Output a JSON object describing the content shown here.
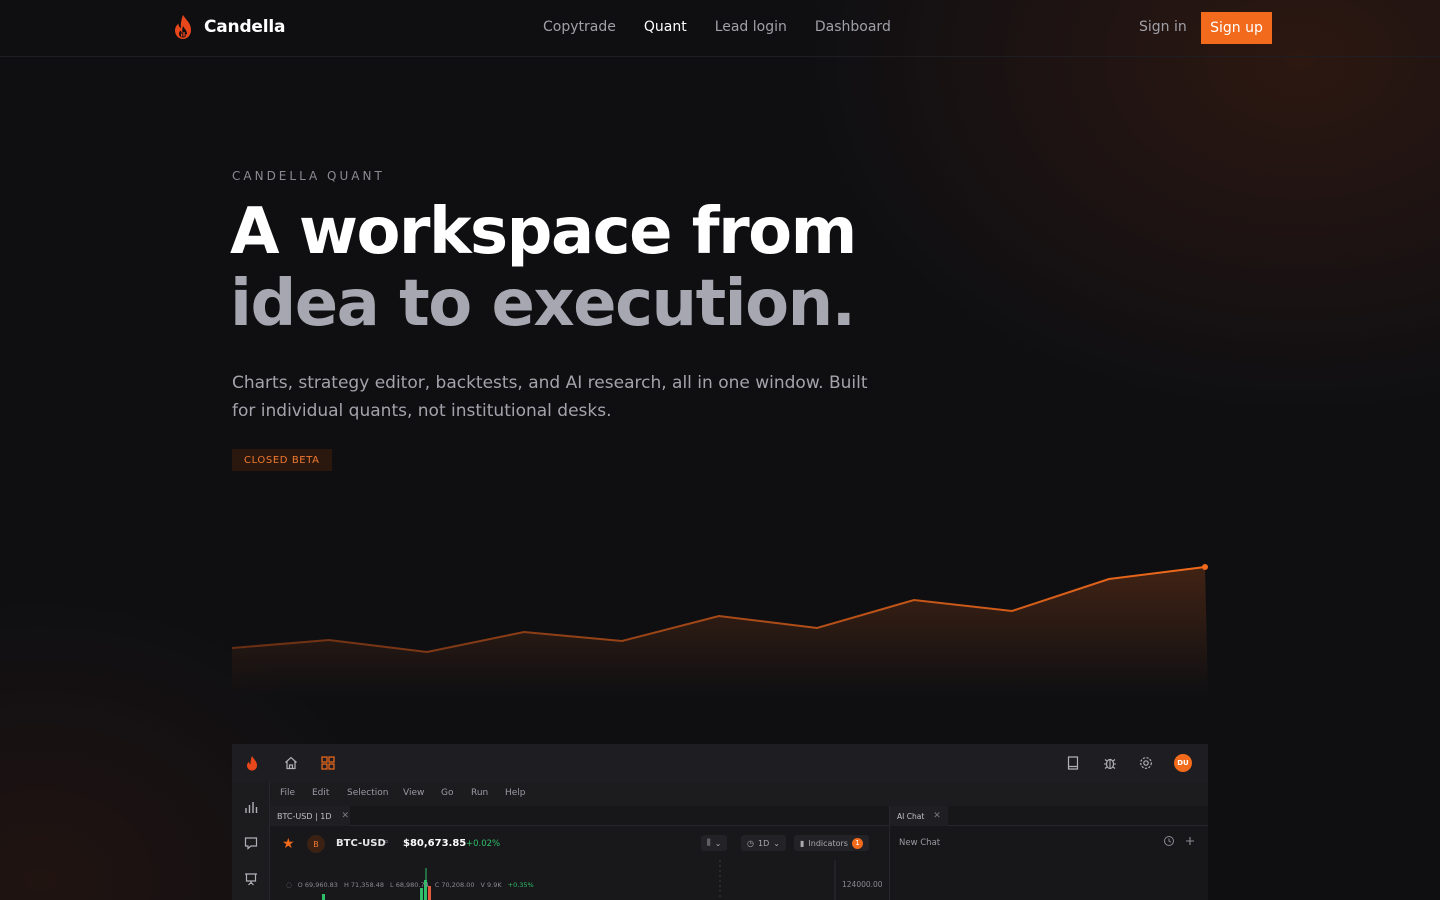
{
  "nav": {
    "brand": "Candella",
    "links": [
      "Copytrade",
      "Quant",
      "Lead login",
      "Dashboard"
    ],
    "active_link": "Quant",
    "signin": "Sign in",
    "signup": "Sign up"
  },
  "hero": {
    "eyebrow": "CANDELLA QUANT",
    "headline_line1": "A workspace from",
    "headline_line2": "idea to execution.",
    "subtitle": "Charts, strategy editor, backtests, and AI research, all in one window. Built for individual quants, not institutional desks.",
    "badge": "CLOSED BETA"
  },
  "app": {
    "menu": [
      "File",
      "Edit",
      "Selection",
      "View",
      "Go",
      "Run",
      "Help"
    ],
    "chart_tab": "BTC-USD | 1D",
    "symbol_badge": "B",
    "symbol": "BTC-USD",
    "price": "$80,673.85",
    "change": "+0.02%",
    "timeframe": "1D",
    "indicators_label": "Indicators",
    "indicators_count": "1",
    "ohlc": {
      "open": "69,960.83",
      "high": "71,358.48",
      "low": "68,980.74",
      "close": "70,208.00",
      "volume": "9.9K",
      "change": "+0.35%"
    },
    "axis_price": "124000.00",
    "ai_tab": "AI Chat",
    "new_chat": "New Chat",
    "user_initials": "DU"
  },
  "colors": {
    "accent": "#f26a1b",
    "positive": "#2fbf6a",
    "background": "#0f0f12"
  }
}
